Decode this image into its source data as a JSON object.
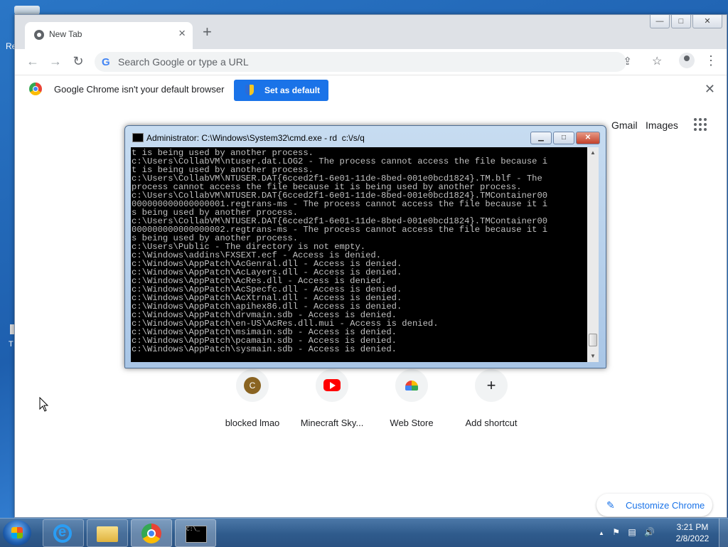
{
  "desktop": {
    "label_fragment": "Re",
    "mark_fragment": "T"
  },
  "chrome": {
    "tab": {
      "title": "New Tab",
      "close": "×"
    },
    "new_tab": "+",
    "window_controls": {
      "minimize": "—",
      "maximize": "□",
      "close": "✕"
    },
    "toolbar": {
      "back": "←",
      "forward": "→",
      "reload": "↻",
      "omnibox_logo": "G",
      "omnibox_placeholder": "Search Google or type a URL",
      "share": "⇪",
      "bookmark": "☆",
      "menu": "⋮"
    },
    "infobar": {
      "message": "Google Chrome isn't your default browser",
      "button": "Set as default",
      "close": "✕"
    },
    "page": {
      "links": [
        "Gmail",
        "Images"
      ],
      "shortcuts": [
        {
          "label": "blocked lmao",
          "icon": "letter-c-icon",
          "letter": "C"
        },
        {
          "label": "Minecraft Sky...",
          "icon": "youtube-icon"
        },
        {
          "label": "Web Store",
          "icon": "web-store-icon"
        },
        {
          "label": "Add shortcut",
          "icon": "plus-icon",
          "symbol": "+"
        }
      ],
      "customize": "Customize Chrome",
      "customize_icon": "✎"
    }
  },
  "cmd": {
    "title": "Administrator: C:\\Windows\\System32\\cmd.exe - rd  c:\\/s/q",
    "controls": {
      "minimize": "▁",
      "maximize": "□",
      "close": "✕"
    },
    "output": [
      "t is being used by another process.",
      "c:\\Users\\CollabVM\\ntuser.dat.LOG2 - The process cannot access the file because i",
      "t is being used by another process.",
      "c:\\Users\\CollabVM\\NTUSER.DAT{6cced2f1-6e01-11de-8bed-001e0bcd1824}.TM.blf - The",
      "process cannot access the file because it is being used by another process.",
      "c:\\Users\\CollabVM\\NTUSER.DAT{6cced2f1-6e01-11de-8bed-001e0bcd1824}.TMContainer00",
      "000000000000000001.regtrans-ms - The process cannot access the file because it i",
      "s being used by another process.",
      "c:\\Users\\CollabVM\\NTUSER.DAT{6cced2f1-6e01-11de-8bed-001e0bcd1824}.TMContainer00",
      "000000000000000002.regtrans-ms - The process cannot access the file because it i",
      "s being used by another process.",
      "c:\\Users\\Public - The directory is not empty.",
      "c:\\Windows\\addins\\FXSEXT.ecf - Access is denied.",
      "c:\\Windows\\AppPatch\\AcGenral.dll - Access is denied.",
      "c:\\Windows\\AppPatch\\AcLayers.dll - Access is denied.",
      "c:\\Windows\\AppPatch\\AcRes.dll - Access is denied.",
      "c:\\Windows\\AppPatch\\AcSpecfc.dll - Access is denied.",
      "c:\\Windows\\AppPatch\\AcXtrnal.dll - Access is denied.",
      "c:\\Windows\\AppPatch\\apihex86.dll - Access is denied.",
      "c:\\Windows\\AppPatch\\drvmain.sdb - Access is denied.",
      "c:\\Windows\\AppPatch\\en-US\\AcRes.dll.mui - Access is denied.",
      "c:\\Windows\\AppPatch\\msimain.sdb - Access is denied.",
      "c:\\Windows\\AppPatch\\pcamain.sdb - Access is denied.",
      "c:\\Windows\\AppPatch\\sysmain.sdb - Access is denied."
    ],
    "scroll_up": "▲",
    "scroll_down": "▼"
  },
  "taskbar": {
    "items": [
      "internet-explorer-icon",
      "explorer-folder-icon",
      "chrome-icon",
      "cmd-icon"
    ],
    "cmd_glyph": "C:\\_",
    "tray": {
      "up": "▲",
      "flag": "⚑",
      "network": "▤",
      "volume": "🔊"
    },
    "time": "3:21 PM",
    "date": "2/8/2022"
  }
}
